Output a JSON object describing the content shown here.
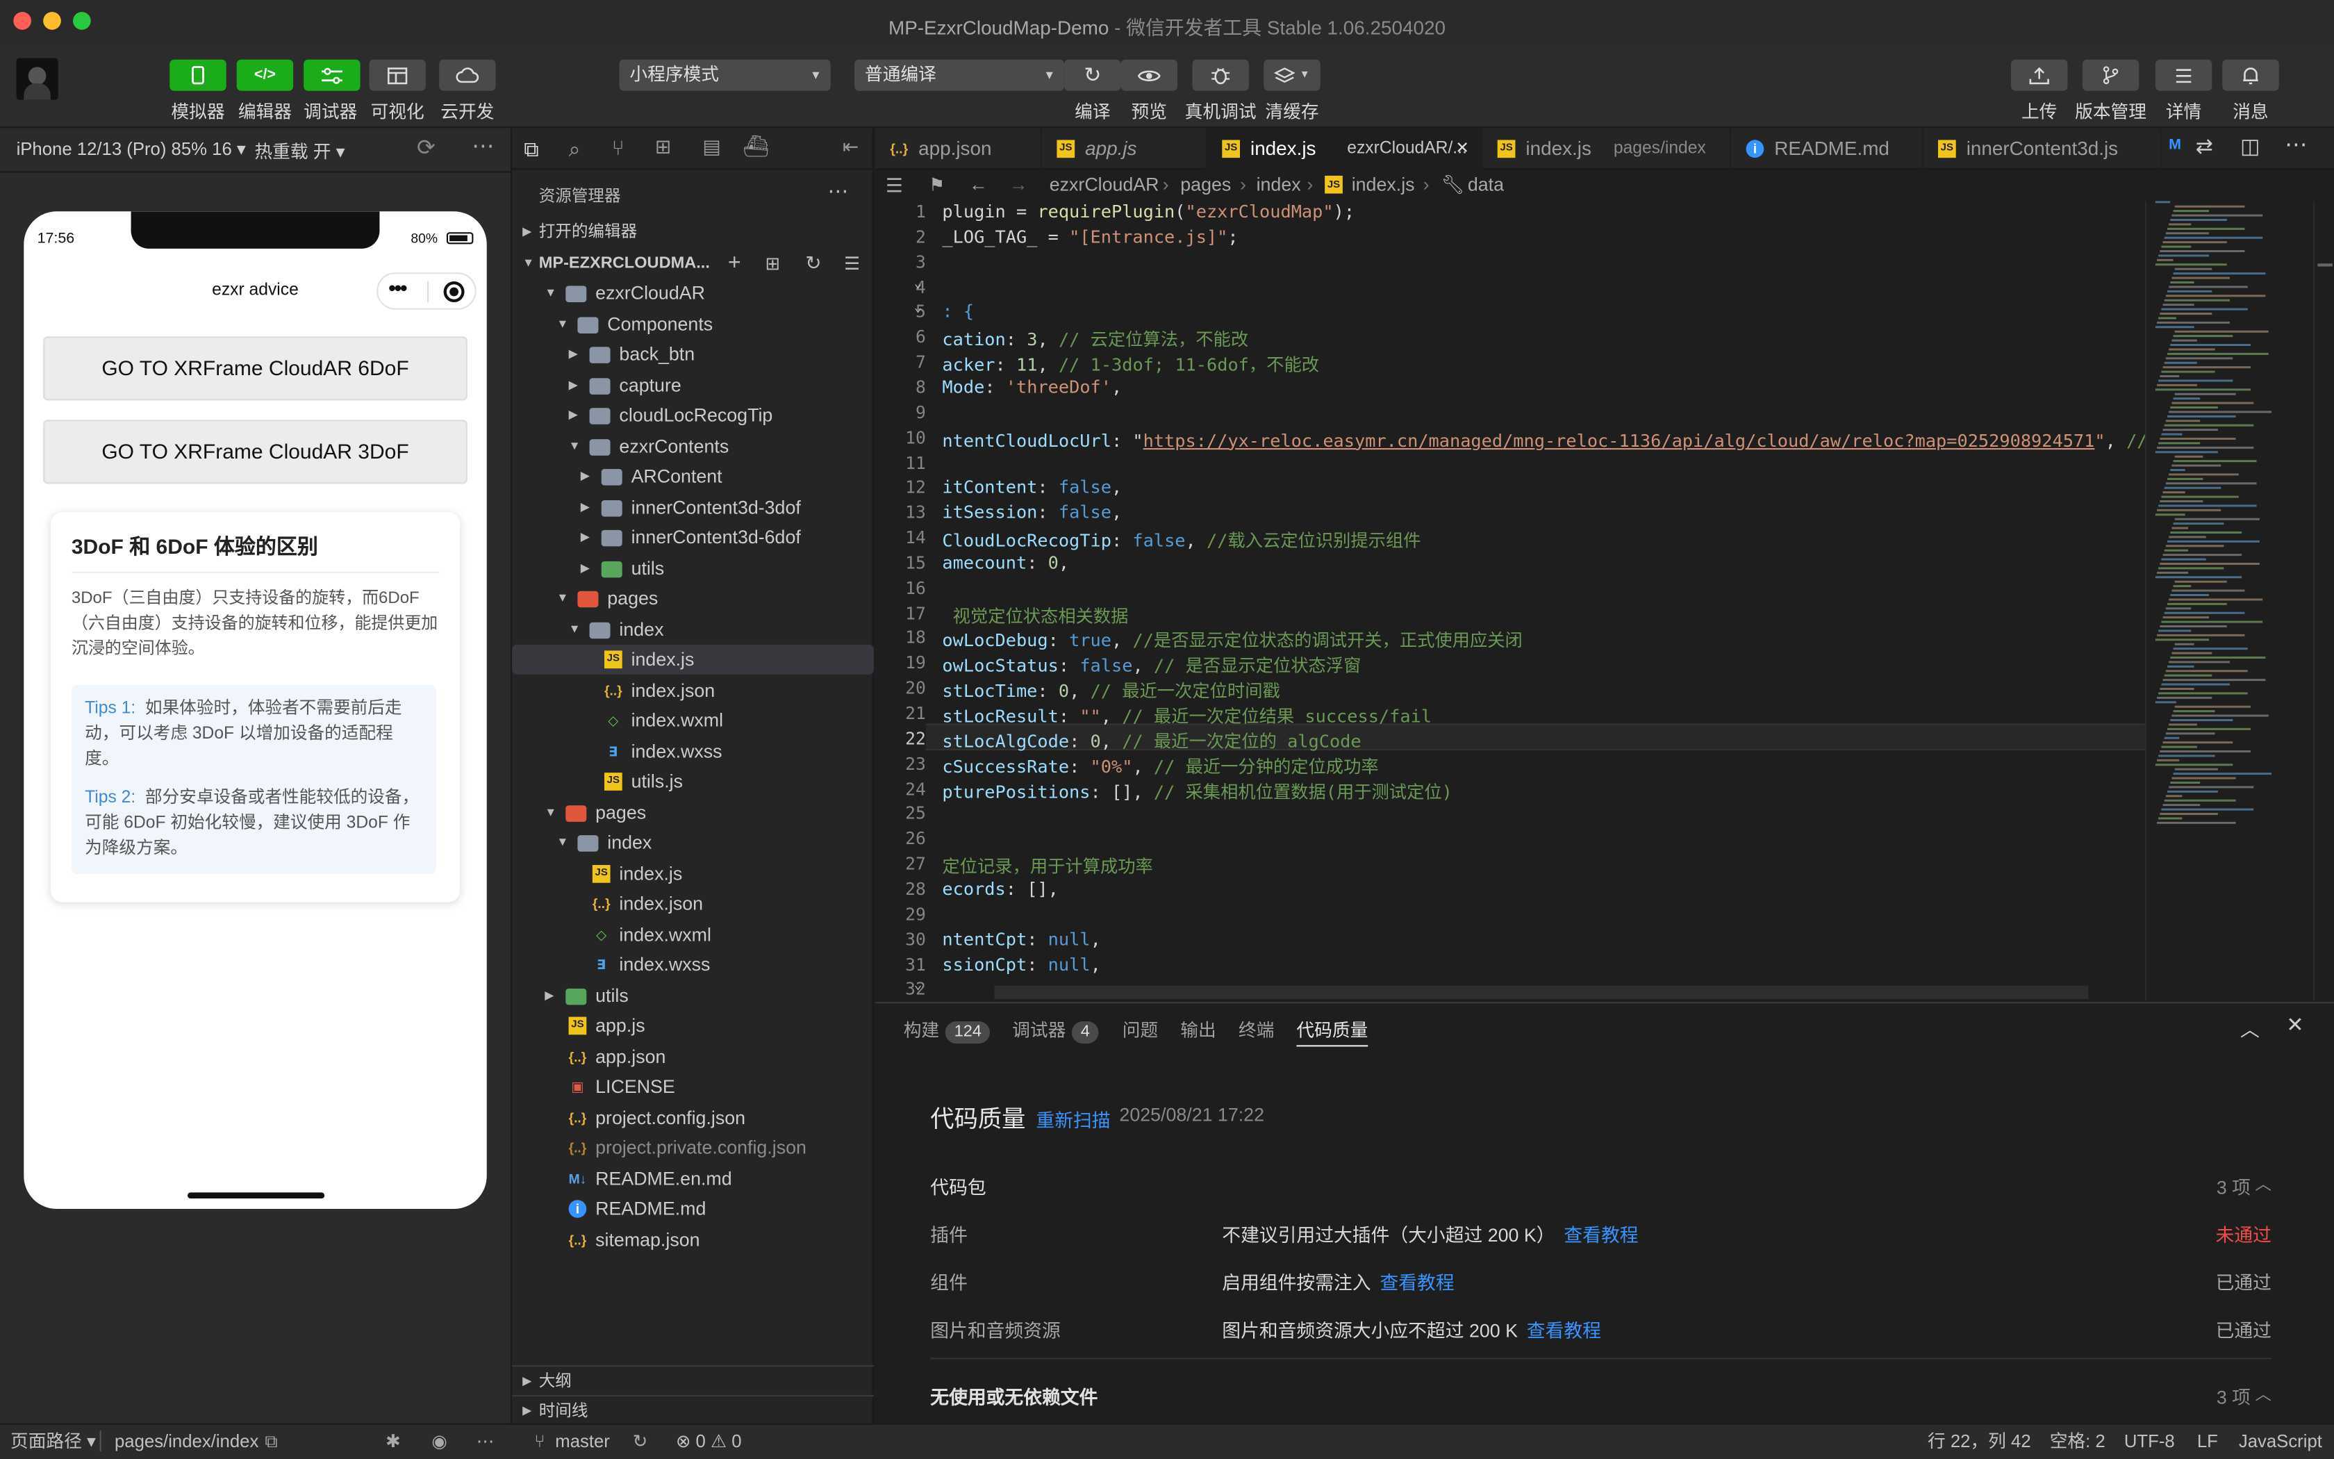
{
  "window": {
    "title": "MP-EzxrCloudMap-Demo",
    "subtitle": " - 微信开发者工具 Stable 1.06.2504020"
  },
  "toolbar": {
    "left_buttons": [
      "模拟器",
      "编辑器",
      "调试器",
      "可视化",
      "云开发"
    ],
    "mode_select": "小程序模式",
    "compile_select": "普通编译",
    "center_buttons": [
      "编译",
      "预览",
      "真机调试",
      "清缓存"
    ],
    "right_buttons": [
      "上传",
      "版本管理",
      "详情",
      "消息"
    ]
  },
  "simulator": {
    "device": "iPhone 12/13 (Pro) 85% 16 ▾",
    "hotreload": "热重载 开 ▾",
    "time": "17:56",
    "battery": "80%",
    "nav_title": "ezxr advice",
    "buttons": [
      "GO TO XRFrame CloudAR 6DoF",
      "GO TO XRFrame CloudAR 3DoF"
    ],
    "card": {
      "title": "3DoF 和 6DoF 体验的区别",
      "desc": "3DoF（三自由度）只支持设备的旋转，而6DoF（六自由度）支持设备的旋转和位移，能提供更加沉浸的空间体验。",
      "tip1_label": "Tips 1:",
      "tip1_text": "如果体验时，体验者不需要前后走动，可以考虑 3DoF 以增加设备的适配程度。",
      "tip2_label": "Tips 2:",
      "tip2_text": "部分安卓设备或者性能较低的设备，可能 6DoF 初始化较慢，建议使用 3DoF 作为降级方案。"
    }
  },
  "explorer": {
    "title": "资源管理器",
    "open_editors": "打开的编辑器",
    "project": "MP-EZXRCLOUDMA...",
    "tree": [
      {
        "label": "ezxrCloudAR",
        "type": "folder-open",
        "depth": 1
      },
      {
        "label": "Components",
        "type": "folder-open",
        "depth": 2
      },
      {
        "label": "back_btn",
        "type": "folder",
        "depth": 3
      },
      {
        "label": "capture",
        "type": "folder",
        "depth": 3
      },
      {
        "label": "cloudLocRecogTip",
        "type": "folder",
        "depth": 3
      },
      {
        "label": "ezxrContents",
        "type": "folder-open",
        "depth": 3
      },
      {
        "label": "ARContent",
        "type": "folder",
        "depth": 4
      },
      {
        "label": "innerContent3d-3dof",
        "type": "folder",
        "depth": 4
      },
      {
        "label": "innerContent3d-6dof",
        "type": "folder",
        "depth": 4
      },
      {
        "label": "utils",
        "type": "folder-green",
        "depth": 4
      },
      {
        "label": "pages",
        "type": "folder-red-open",
        "depth": 2
      },
      {
        "label": "index",
        "type": "folder-open",
        "depth": 3
      },
      {
        "label": "index.js",
        "type": "js",
        "depth": 4,
        "selected": true
      },
      {
        "label": "index.json",
        "type": "json",
        "depth": 4
      },
      {
        "label": "index.wxml",
        "type": "wxml",
        "depth": 4
      },
      {
        "label": "index.wxss",
        "type": "wxss",
        "depth": 4
      },
      {
        "label": "utils.js",
        "type": "js",
        "depth": 4
      },
      {
        "label": "pages",
        "type": "folder-red-open",
        "depth": 1
      },
      {
        "label": "index",
        "type": "folder-open",
        "depth": 2
      },
      {
        "label": "index.js",
        "type": "js",
        "depth": 3
      },
      {
        "label": "index.json",
        "type": "json",
        "depth": 3
      },
      {
        "label": "index.wxml",
        "type": "wxml",
        "depth": 3
      },
      {
        "label": "index.wxss",
        "type": "wxss",
        "depth": 3
      },
      {
        "label": "utils",
        "type": "folder-green",
        "depth": 1
      },
      {
        "label": "app.js",
        "type": "js",
        "depth": 1
      },
      {
        "label": "app.json",
        "type": "json",
        "depth": 1
      },
      {
        "label": "LICENSE",
        "type": "license",
        "depth": 1
      },
      {
        "label": "project.config.json",
        "type": "json",
        "depth": 1
      },
      {
        "label": "project.private.config.json",
        "type": "json-dim",
        "depth": 1
      },
      {
        "label": "README.en.md",
        "type": "md",
        "depth": 1
      },
      {
        "label": "README.md",
        "type": "info",
        "depth": 1
      },
      {
        "label": "sitemap.json",
        "type": "json",
        "depth": 1
      }
    ],
    "outline": "大纲",
    "timeline": "时间线"
  },
  "tabs": [
    {
      "name": "app.json",
      "hint": "",
      "type": "json"
    },
    {
      "name": "app.js",
      "hint": "",
      "type": "js",
      "italic": true
    },
    {
      "name": "index.js",
      "hint": "ezxrCloudAR/...",
      "type": "js",
      "active": true
    },
    {
      "name": "index.js",
      "hint": "pages/index",
      "type": "js"
    },
    {
      "name": "README.md",
      "hint": "",
      "type": "info"
    },
    {
      "name": "innerContent3d.js",
      "hint": "",
      "type": "js"
    }
  ],
  "breadcrumb": [
    "ezxrCloudAR",
    "pages",
    "index",
    "index.js",
    "data"
  ],
  "code_lines": [
    {
      "n": "1",
      "parts": [
        [
          "p",
          "plugin = "
        ],
        [
          "f",
          "requirePlugin"
        ],
        [
          "p",
          "("
        ],
        [
          "s",
          "\"ezxrCloudMap\""
        ],
        [
          "p",
          ");"
        ]
      ]
    },
    {
      "n": "2",
      "parts": [
        [
          "p",
          "_LOG_TAG_ = "
        ],
        [
          "s",
          "\"[Entrance.js]\""
        ],
        [
          "p",
          ";"
        ]
      ]
    },
    {
      "n": "3",
      "parts": []
    },
    {
      "n": "4",
      "parts": []
    },
    {
      "n": "5",
      "parts": [
        [
          "b",
          ": {"
        ]
      ]
    },
    {
      "n": "6",
      "parts": [
        [
          "k",
          "cation"
        ],
        [
          "p",
          ": "
        ],
        [
          "n",
          "3"
        ],
        [
          "p",
          ", "
        ],
        [
          "c",
          "// 云定位算法，不能改"
        ]
      ]
    },
    {
      "n": "7",
      "parts": [
        [
          "k",
          "acker"
        ],
        [
          "p",
          ": "
        ],
        [
          "n",
          "11"
        ],
        [
          "p",
          ", "
        ],
        [
          "c",
          "// 1-3dof; 11-6dof，不能改"
        ]
      ]
    },
    {
      "n": "8",
      "parts": [
        [
          "k",
          "Mode"
        ],
        [
          "p",
          ": "
        ],
        [
          "s",
          "'threeDof'"
        ],
        [
          "p",
          ","
        ]
      ]
    },
    {
      "n": "9",
      "parts": []
    },
    {
      "n": "10",
      "parts": [
        [
          "k",
          "ntentCloudLocUrl"
        ],
        [
          "p",
          ": \""
        ],
        [
          "u",
          "https://yx-reloc.easymr.cn/managed/mng-reloc-1136/api/alg/cloud/aw/reloc?map=0252908924571"
        ],
        [
          "s",
          "\""
        ],
        [
          "p",
          ", "
        ],
        [
          "c",
          "// 云定位"
        ]
      ]
    },
    {
      "n": "11",
      "parts": []
    },
    {
      "n": "12",
      "parts": [
        [
          "k",
          "itContent"
        ],
        [
          "p",
          ": "
        ],
        [
          "b",
          "false"
        ],
        [
          "p",
          ","
        ]
      ]
    },
    {
      "n": "13",
      "parts": [
        [
          "k",
          "itSession"
        ],
        [
          "p",
          ": "
        ],
        [
          "b",
          "false"
        ],
        [
          "p",
          ","
        ]
      ]
    },
    {
      "n": "14",
      "parts": [
        [
          "k",
          "CloudLocRecogTip"
        ],
        [
          "p",
          ": "
        ],
        [
          "b",
          "false"
        ],
        [
          "p",
          ", "
        ],
        [
          "c",
          "//载入云定位识别提示组件"
        ]
      ]
    },
    {
      "n": "15",
      "parts": [
        [
          "k",
          "amecount"
        ],
        [
          "p",
          ": "
        ],
        [
          "n",
          "0"
        ],
        [
          "p",
          ","
        ]
      ]
    },
    {
      "n": "16",
      "parts": []
    },
    {
      "n": "17",
      "parts": [
        [
          "c",
          " 视觉定位状态相关数据"
        ]
      ]
    },
    {
      "n": "18",
      "parts": [
        [
          "k",
          "owLocDebug"
        ],
        [
          "p",
          ": "
        ],
        [
          "b",
          "true"
        ],
        [
          "p",
          ", "
        ],
        [
          "c",
          "//是否显示定位状态的调试开关，正式使用应关闭"
        ]
      ]
    },
    {
      "n": "19",
      "parts": [
        [
          "k",
          "owLocStatus"
        ],
        [
          "p",
          ": "
        ],
        [
          "b",
          "false"
        ],
        [
          "p",
          ", "
        ],
        [
          "c",
          "// 是否显示定位状态浮窗"
        ]
      ]
    },
    {
      "n": "20",
      "parts": [
        [
          "k",
          "stLocTime"
        ],
        [
          "p",
          ": "
        ],
        [
          "n",
          "0"
        ],
        [
          "p",
          ", "
        ],
        [
          "c",
          "// 最近一次定位时间戳"
        ]
      ]
    },
    {
      "n": "21",
      "parts": [
        [
          "k",
          "stLocResult"
        ],
        [
          "p",
          ": "
        ],
        [
          "s",
          "\"\""
        ],
        [
          "p",
          ", "
        ],
        [
          "c",
          "// 最近一次定位结果 success/fail"
        ]
      ]
    },
    {
      "n": "22",
      "parts": [
        [
          "k",
          "stLocAlgCode"
        ],
        [
          "p",
          ": "
        ],
        [
          "n",
          "0"
        ],
        [
          "p",
          ", "
        ],
        [
          "c",
          "// 最近一次定位的 algCode"
        ]
      ]
    },
    {
      "n": "23",
      "parts": [
        [
          "k",
          "cSuccessRate"
        ],
        [
          "p",
          ": "
        ],
        [
          "s",
          "\"0%\""
        ],
        [
          "p",
          ", "
        ],
        [
          "c",
          "// 最近一分钟的定位成功率"
        ]
      ]
    },
    {
      "n": "24",
      "parts": [
        [
          "k",
          "ptureP​ositions"
        ],
        [
          "p",
          ": [], "
        ],
        [
          "c",
          "// 采集相机位置数据(用于测试定位)"
        ]
      ]
    },
    {
      "n": "25",
      "parts": []
    },
    {
      "n": "26",
      "parts": []
    },
    {
      "n": "27",
      "parts": [
        [
          "c",
          "定位记录，用于计算成功率"
        ]
      ]
    },
    {
      "n": "28",
      "parts": [
        [
          "k",
          "ecords"
        ],
        [
          "p",
          ": [],"
        ]
      ]
    },
    {
      "n": "29",
      "parts": []
    },
    {
      "n": "30",
      "parts": [
        [
          "k",
          "ntentCpt"
        ],
        [
          "p",
          ": "
        ],
        [
          "b",
          "null"
        ],
        [
          "p",
          ","
        ]
      ]
    },
    {
      "n": "31",
      "parts": [
        [
          "k",
          "ssionCpt"
        ],
        [
          "p",
          ": "
        ],
        [
          "b",
          "null"
        ],
        [
          "p",
          ","
        ]
      ]
    },
    {
      "n": "32",
      "parts": []
    }
  ],
  "panel": {
    "tabs": [
      {
        "label": "构建",
        "badge": "124"
      },
      {
        "label": "调试器",
        "badge": "4"
      },
      {
        "label": "问题",
        "badge": ""
      },
      {
        "label": "输出",
        "badge": ""
      },
      {
        "label": "终端",
        "badge": ""
      },
      {
        "label": "代码质量",
        "badge": "",
        "active": true
      }
    ],
    "heading": "代码质量",
    "rescan": "重新扫描",
    "timestamp": "2025/08/21 17:22",
    "section1": {
      "title": "代码包",
      "count": "3 项"
    },
    "rows": [
      {
        "name": "插件",
        "desc": "不建议引用过大插件（大小超过 200 K）",
        "link": "查看教程",
        "status": "未通过",
        "fail": true
      },
      {
        "name": "组件",
        "desc": "启用组件按需注入",
        "link": "查看教程",
        "status": "已通过",
        "fail": false
      },
      {
        "name": "图片和音频资源",
        "desc": "图片和音频资源大小应不超过 200 K",
        "link": "查看教程",
        "status": "已通过",
        "fail": false
      }
    ],
    "section2": {
      "title": "无使用或无依赖文件",
      "count": "3 项"
    }
  },
  "status": {
    "path_label": "页面路径 ▾",
    "path": "pages/index/index",
    "branch": "master",
    "problems": "⊗ 0 ⚠ 0",
    "cursor": "行 22，列 42",
    "spaces": "空格: 2",
    "encoding": "UTF-8",
    "eol": "LF",
    "language": "JavaScript"
  },
  "colors": {
    "accent_green": "#1aad19",
    "link": "#3794ff",
    "fail": "#f14c4c",
    "selection": "#37373d"
  }
}
